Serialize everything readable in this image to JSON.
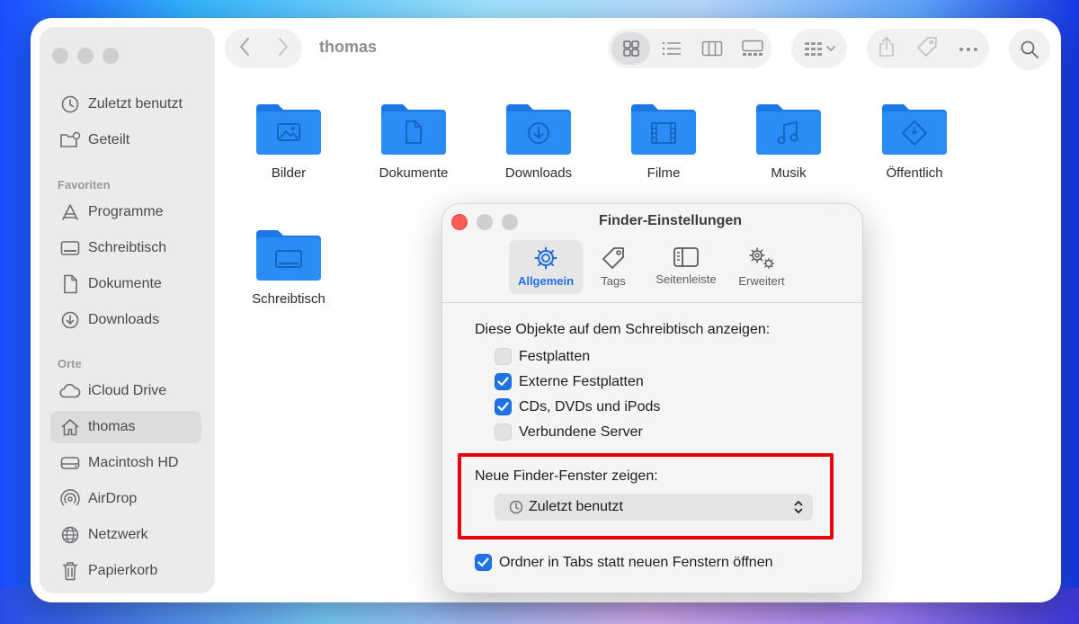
{
  "colors": {
    "accent": "#1f72e8",
    "folder": "#2a8cf5",
    "highlight_border": "#e8000d",
    "close_button": "#ff5f57"
  },
  "window": {
    "title": "thomas"
  },
  "sidebar": {
    "top_items": [
      {
        "label": "Zuletzt benutzt",
        "icon": "clock-icon"
      },
      {
        "label": "Geteilt",
        "icon": "shared-folder-icon"
      }
    ],
    "favorites_header": "Favoriten",
    "favorites": [
      {
        "label": "Programme",
        "icon": "applications-icon"
      },
      {
        "label": "Schreibtisch",
        "icon": "desktop-icon"
      },
      {
        "label": "Dokumente",
        "icon": "document-icon"
      },
      {
        "label": "Downloads",
        "icon": "download-icon"
      }
    ],
    "locations_header": "Orte",
    "locations": [
      {
        "label": "iCloud Drive",
        "icon": "cloud-icon"
      },
      {
        "label": "thomas",
        "icon": "home-icon",
        "selected": true
      },
      {
        "label": "Macintosh HD",
        "icon": "drive-icon"
      },
      {
        "label": "AirDrop",
        "icon": "airdrop-icon"
      },
      {
        "label": "Netzwerk",
        "icon": "globe-icon"
      },
      {
        "label": "Papierkorb",
        "icon": "trash-icon"
      }
    ]
  },
  "folders": [
    {
      "label": "Bilder",
      "glyph": "image-icon"
    },
    {
      "label": "Dokumente",
      "glyph": "document-icon"
    },
    {
      "label": "Downloads",
      "glyph": "download-icon"
    },
    {
      "label": "Filme",
      "glyph": "film-icon"
    },
    {
      "label": "Musik",
      "glyph": "music-icon"
    },
    {
      "label": "Öffentlich",
      "glyph": "public-icon"
    },
    {
      "label": "Schreibtisch",
      "glyph": "desktop-icon"
    }
  ],
  "dialog": {
    "title": "Finder-Einstellungen",
    "tabs": [
      {
        "label": "Allgemein",
        "icon": "gear-icon",
        "active": true
      },
      {
        "label": "Tags",
        "icon": "tag-icon"
      },
      {
        "label": "Seitenleiste",
        "icon": "sidebar-icon"
      },
      {
        "label": "Erweitert",
        "icon": "gears-icon"
      }
    ],
    "desktop_heading": "Diese Objekte auf dem Schreibtisch anzeigen:",
    "checkboxes": [
      {
        "label": "Festplatten",
        "checked": false
      },
      {
        "label": "Externe Festplatten",
        "checked": true
      },
      {
        "label": "CDs, DVDs und iPods",
        "checked": true
      },
      {
        "label": "Verbundene Server",
        "checked": false
      }
    ],
    "new_window_heading": "Neue Finder-Fenster zeigen:",
    "new_window_value": "Zuletzt benutzt",
    "tabs_option": {
      "label": "Ordner in Tabs statt neuen Fenstern öffnen",
      "checked": true
    }
  }
}
